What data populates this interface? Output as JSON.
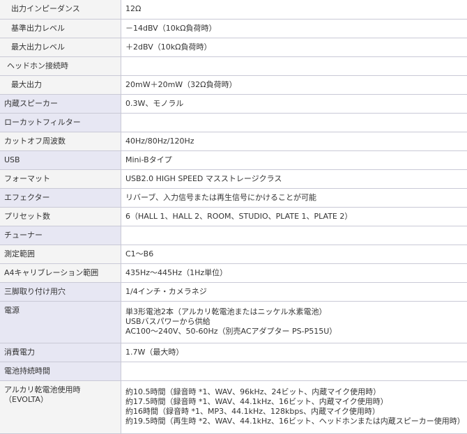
{
  "rows": [
    {
      "label": "出力インピーダンス",
      "value": "12Ω"
    },
    {
      "label": "基準出力レベル",
      "value": "－14dBV（10kΩ負荷時）"
    },
    {
      "label": "最大出力レベル",
      "value": "＋2dBV（10kΩ負荷時）"
    },
    {
      "label": "ヘッドホン接続時",
      "value": ""
    },
    {
      "label": "最大出力",
      "value": "20mW＋20mW（32Ω負荷時）"
    },
    {
      "label": "内蔵スピーカー",
      "value": "0.3W、モノラル"
    },
    {
      "label": "ローカットフィルター",
      "value": ""
    },
    {
      "label": "カットオフ周波数",
      "value": "40Hz/80Hz/120Hz"
    },
    {
      "label": "USB",
      "value": "Mini-Bタイプ"
    },
    {
      "label": "フォーマット",
      "value": "USB2.0 HIGH SPEED マスストレージクラス"
    },
    {
      "label": "エフェクター",
      "value": "リバーブ、入力信号または再生信号にかけることが可能"
    },
    {
      "label": "プリセット数",
      "value": "6（HALL 1、HALL 2、ROOM、STUDIO、PLATE 1、PLATE 2）"
    },
    {
      "label": "チューナー",
      "value": ""
    },
    {
      "label": "測定範囲",
      "value": "C1～B6"
    },
    {
      "label": "A4キャリブレーション範囲",
      "value": "435Hz～445Hz（1Hz単位）"
    },
    {
      "label": "三脚取り付け用穴",
      "value": "1/4インチ・カメラネジ"
    },
    {
      "label": "電源",
      "lines": [
        "単3形電池2本（アルカリ乾電池またはニッケル水素電池）",
        "USBバスパワーから供給",
        "AC100～240V、50-60Hz（別売ACアダプター PS-P515U）"
      ]
    },
    {
      "label": "消費電力",
      "value": "1.7W（最大時）"
    },
    {
      "label": "電池持続時間",
      "value": ""
    },
    {
      "label": "アルカリ乾電池使用時",
      "label2": "（EVOLTA）",
      "lines": [
        "約10.5時間（録音時 *1、WAV、96kHz、24ビット、内蔵マイク使用時）",
        "約17.5時間（録音時 *1、WAV、44.1kHz、16ビット、内蔵マイク使用時）",
        "約16時間（録音時 *1、MP3、44.1kHz、128kbps、内蔵マイク使用時）",
        "約19.5時間（再生時 *2、WAV、44.1kHz、16ビット、ヘッドホンまたは内蔵スピーカー使用時）"
      ]
    }
  ]
}
